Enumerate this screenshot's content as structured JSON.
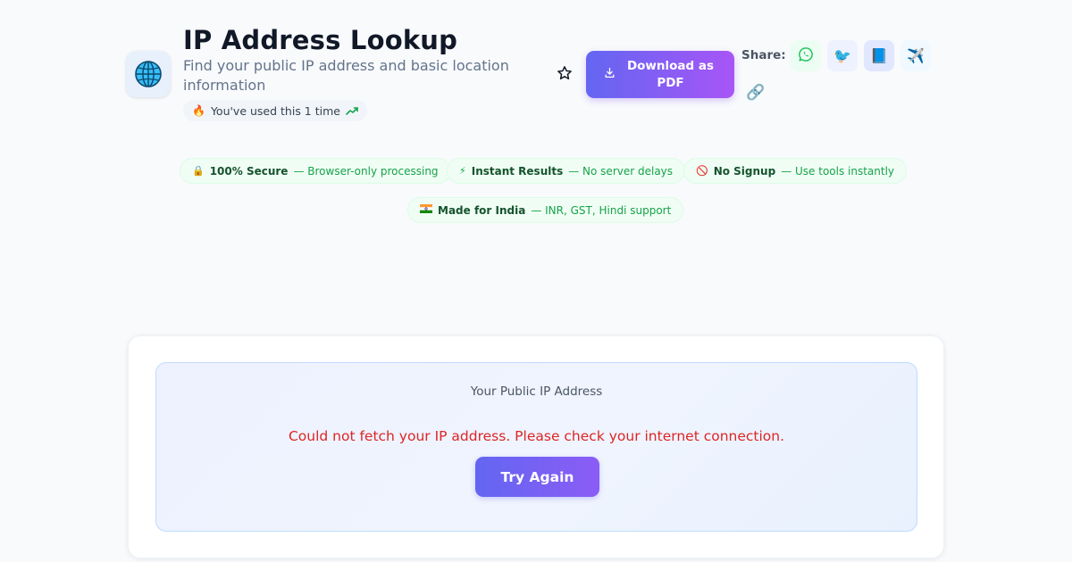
{
  "header": {
    "icon": "globe-icon",
    "title": "IP Address Lookup",
    "subtitle": "Find your public IP address and basic location information",
    "usage": {
      "emoji": "🔥",
      "text": "You've used this 1 time",
      "trend_icon": "trending-up-icon"
    }
  },
  "actions": {
    "favorite_icon": "star-icon",
    "download_label": "Download as PDF",
    "download_icon": "download-icon"
  },
  "share": {
    "label": "Share:",
    "items": [
      {
        "name": "whatsapp",
        "icon": "whatsapp-icon"
      },
      {
        "name": "twitter",
        "icon": "bird-icon",
        "glyph": "🐦"
      },
      {
        "name": "facebook",
        "icon": "book-icon",
        "glyph": "📘"
      },
      {
        "name": "telegram",
        "icon": "airplane-icon",
        "glyph": "✈️"
      },
      {
        "name": "copy-link",
        "icon": "link-icon",
        "glyph": "🔗"
      }
    ]
  },
  "badges": [
    {
      "emoji": "🔒",
      "title": "100% Secure",
      "desc": "— Browser-only processing"
    },
    {
      "emoji": "⚡",
      "title": "Instant Results",
      "desc": "— No server delays"
    },
    {
      "emoji": "🚫",
      "title": "No Signup",
      "desc": "— Use tools instantly"
    },
    {
      "emoji": "🇮🇳",
      "title": "Made for India",
      "desc": "— INR, GST, Hindi support"
    }
  ],
  "ip_card": {
    "label": "Your Public IP Address",
    "error": "Could not fetch your IP address. Please check your internet connection.",
    "retry_label": "Try Again"
  },
  "colors": {
    "accent_start": "#6366f1",
    "accent_end": "#a855f7",
    "error": "#dc2626",
    "badge_text": "#16a34a"
  }
}
